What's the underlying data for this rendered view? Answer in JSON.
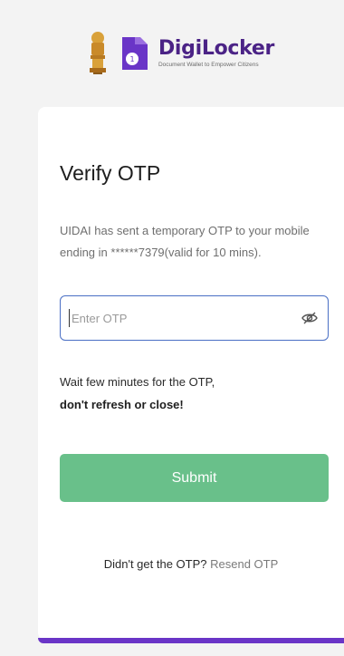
{
  "header": {
    "brand_title": "DigiLocker",
    "brand_subtitle": "Document Wallet to Empower Citizens",
    "brand_color": "#4b2386"
  },
  "card": {
    "title": "Verify OTP",
    "description": "UIDAI has sent a temporary OTP to your mobile ending in ******7379(valid for 10 mins).",
    "otp_input": {
      "placeholder": "Enter OTP",
      "value": ""
    },
    "eye_icon": "eye-off-icon",
    "wait_text": "Wait few minutes for the OTP,",
    "warning_text": "don't refresh or close!",
    "submit_label": "Submit",
    "submit_color": "#69c08a",
    "resend_prompt": "Didn't get the OTP?",
    "resend_link": "Resend OTP",
    "accent_color": "#6a35c7"
  }
}
